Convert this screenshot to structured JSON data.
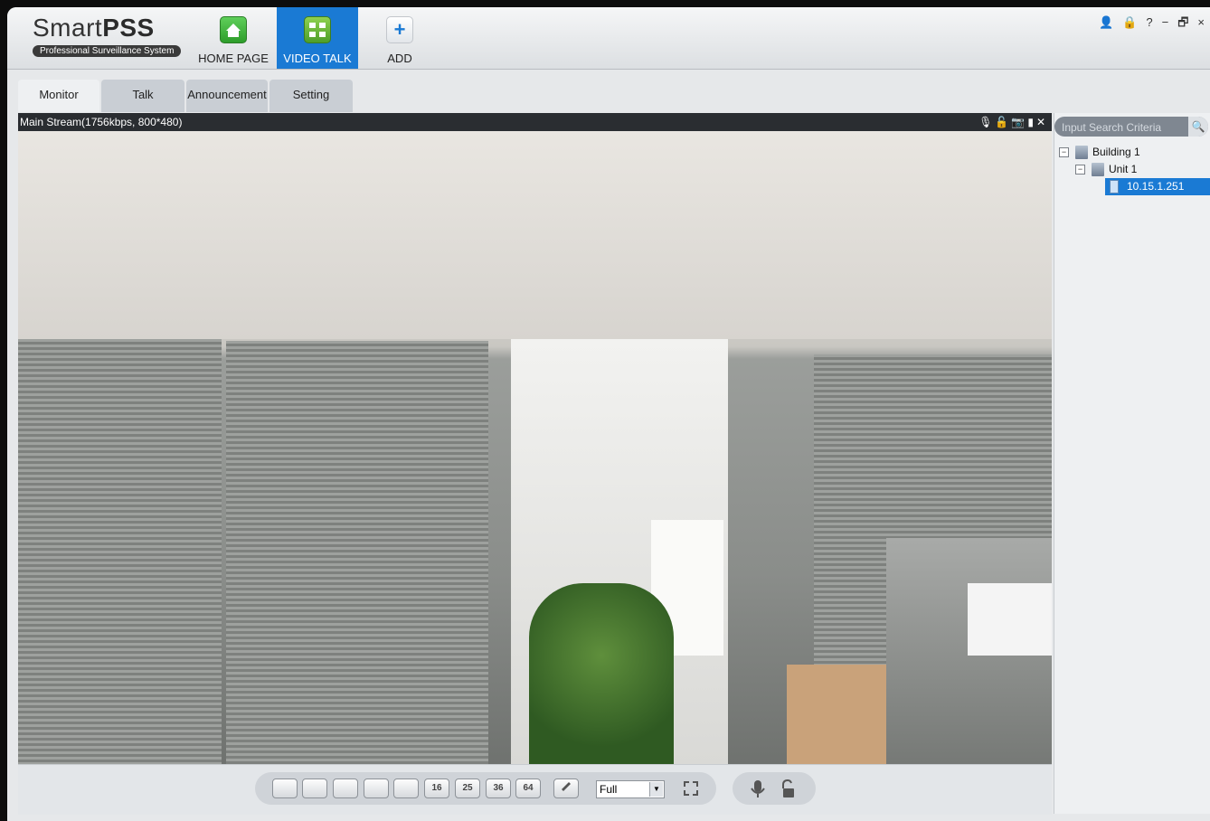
{
  "app": {
    "logo_main": "Smart",
    "logo_bold": "PSS",
    "logo_sub": "Professional Surveillance System"
  },
  "nav": {
    "home_label": "HOME PAGE",
    "videotalk_label": "VIDEO TALK",
    "add_label": "ADD"
  },
  "window_controls": {
    "user": "👤",
    "lock": "🔒",
    "help": "?",
    "minimize": "−",
    "restore": "🗗",
    "close": "×"
  },
  "tabs": [
    {
      "label": "Monitor"
    },
    {
      "label": "Talk"
    },
    {
      "label": "Announcement"
    },
    {
      "label": "Setting"
    }
  ],
  "video": {
    "stream_info": "Main Stream(1756kbps, 800*480)"
  },
  "bottombar": {
    "layout_buttons": [
      "",
      "",
      "",
      "",
      "",
      "16",
      "25",
      "36",
      "64"
    ],
    "stream_select_value": "Full"
  },
  "search": {
    "placeholder": "Input Search Criteria"
  },
  "tree": {
    "building": "Building 1",
    "unit": "Unit 1",
    "device": "10.15.1.251"
  },
  "colors": {
    "accent": "#1a7ad4"
  }
}
